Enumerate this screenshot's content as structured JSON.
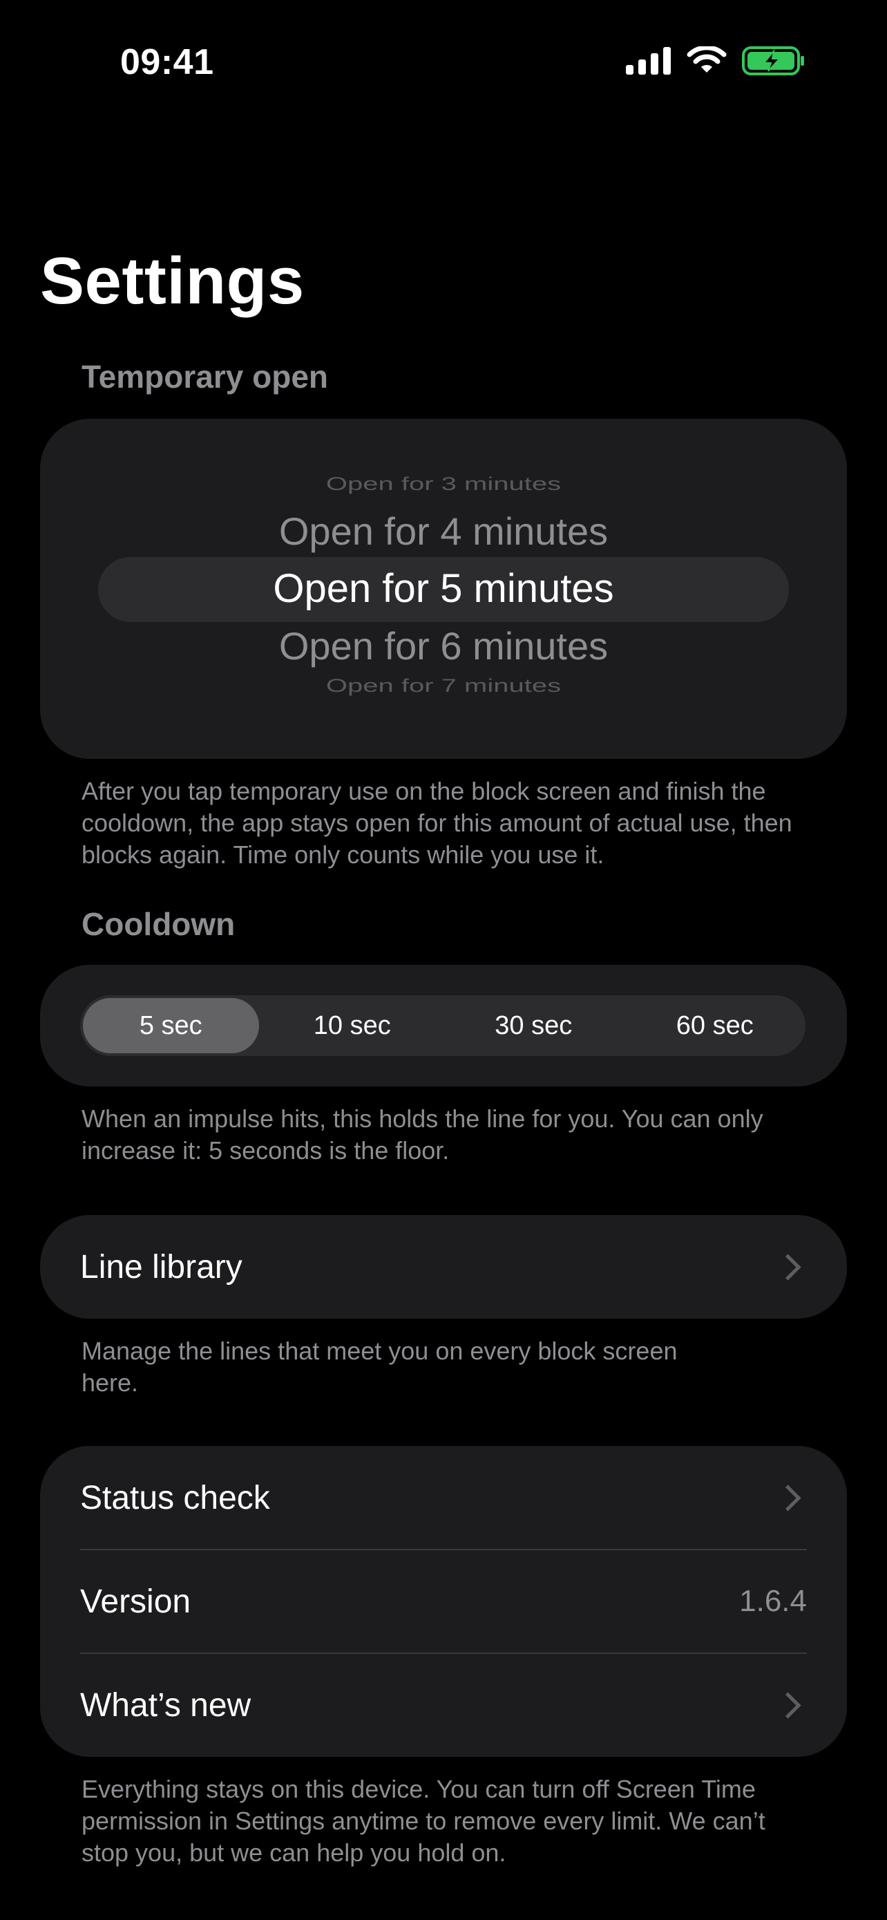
{
  "status_bar": {
    "time": "09:41"
  },
  "page": {
    "title": "Settings"
  },
  "temporary_open": {
    "header": "Temporary open",
    "options": [
      "Open for 3 minutes",
      "Open for 4 minutes",
      "Open for 5 minutes",
      "Open for 6 minutes",
      "Open for 7 minutes"
    ],
    "selected": "Open for 5 minutes",
    "footnote": "After you tap temporary use on the block screen and finish the cooldown, the app stays open for this amount of actual use, then blocks again. Time only counts while you use it."
  },
  "cooldown": {
    "header": "Cooldown",
    "options": [
      "5 sec",
      "10 sec",
      "30 sec",
      "60 sec"
    ],
    "selected": "5 sec",
    "footnote": "When an impulse hits, this holds the line for you. You can only increase it: 5 seconds is the floor."
  },
  "line_library": {
    "label": "Line library",
    "footnote": "Manage the lines that meet you on every block screen here."
  },
  "info_group": {
    "status_check": "Status check",
    "version_label": "Version",
    "version_value": "1.6.4",
    "whats_new": "What’s new",
    "footnote": "Everything stays on this device. You can turn off Screen Time permission in Settings anytime to remove every limit. We can’t stop you, but we can help you hold on."
  },
  "colors": {
    "background": "#000000",
    "card": "#1c1c1e",
    "secondary_text": "#8e8e93",
    "battery_green": "#34c759"
  }
}
